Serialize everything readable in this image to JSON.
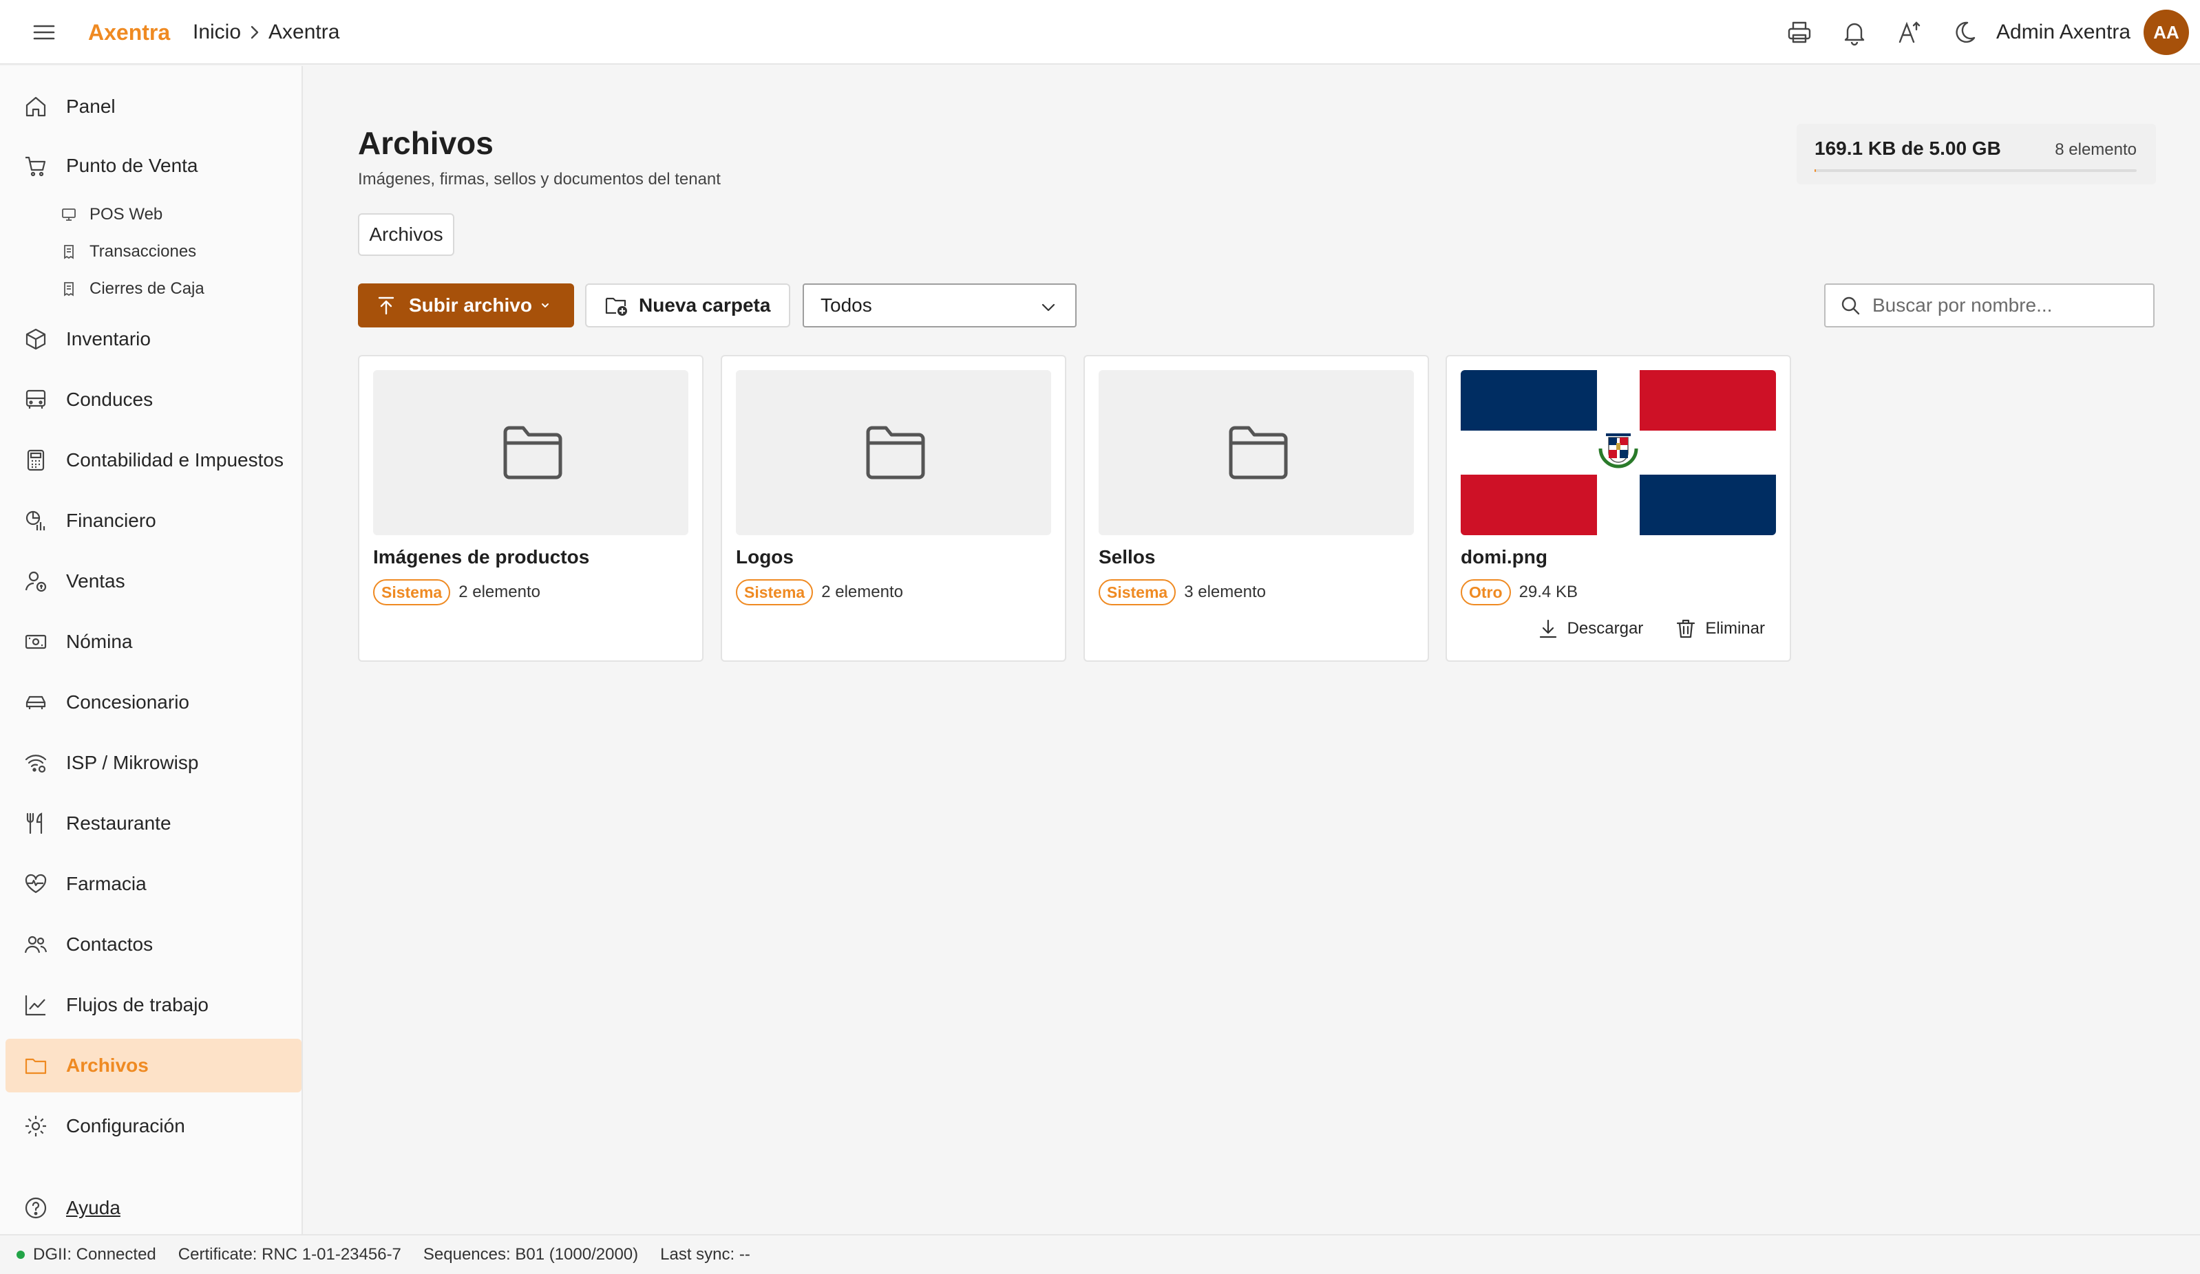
{
  "header": {
    "brand": "Axentra",
    "breadcrumb": [
      "Inicio",
      "Axentra"
    ],
    "user_name": "Admin Axentra",
    "avatar_initials": "AA",
    "icons": [
      "menu-icon",
      "printer-icon",
      "bell-icon",
      "accessibility-icon",
      "moon-icon"
    ]
  },
  "sidebar": {
    "items": [
      {
        "label": "Panel",
        "icon": "home-icon"
      },
      {
        "label": "Punto de Venta",
        "icon": "cart-icon"
      },
      {
        "label": "Inventario",
        "icon": "box-icon"
      },
      {
        "label": "Conduces",
        "icon": "truck-icon"
      },
      {
        "label": "Contabilidad e Impuestos",
        "icon": "calculator-icon"
      },
      {
        "label": "Financiero",
        "icon": "finance-icon"
      },
      {
        "label": "Ventas",
        "icon": "sales-icon"
      },
      {
        "label": "Nómina",
        "icon": "payroll-icon"
      },
      {
        "label": "Concesionario",
        "icon": "car-icon"
      },
      {
        "label": "ISP / Mikrowisp",
        "icon": "wifi-icon"
      },
      {
        "label": "Restaurante",
        "icon": "utensils-icon"
      },
      {
        "label": "Farmacia",
        "icon": "heartbeat-icon"
      },
      {
        "label": "Contactos",
        "icon": "users-icon"
      },
      {
        "label": "Flujos de trabajo",
        "icon": "chart-line-icon"
      },
      {
        "label": "Archivos",
        "icon": "folder-icon"
      },
      {
        "label": "Configuración",
        "icon": "gear-icon"
      }
    ],
    "subitems": [
      {
        "label": "POS Web",
        "icon": "monitor-icon"
      },
      {
        "label": "Transacciones",
        "icon": "receipt-icon"
      },
      {
        "label": "Cierres de Caja",
        "icon": "receipt-icon"
      }
    ],
    "active": "Archivos",
    "help_label": "Ayuda"
  },
  "main": {
    "title": "Archivos",
    "subtitle": "Imágenes, firmas, sellos y documentos del tenant",
    "storage": {
      "used": "169.1 KB de 5.00 GB",
      "count": "8 elemento",
      "usage_fraction": 3e-05
    },
    "tab": "Archivos",
    "upload_label": "Subir archivo",
    "new_folder_label": "Nueva carpeta",
    "filter_value": "Todos",
    "search_placeholder": "Buscar por nombre...",
    "cards": [
      {
        "name": "Imágenes de productos",
        "badge": "Sistema",
        "meta": "2 elemento",
        "kind": "folder"
      },
      {
        "name": "Logos",
        "badge": "Sistema",
        "meta": "2 elemento",
        "kind": "folder"
      },
      {
        "name": "Sellos",
        "badge": "Sistema",
        "meta": "3 elemento",
        "kind": "folder"
      },
      {
        "name": "domi.png",
        "badge": "Otro",
        "meta": "29.4 KB",
        "kind": "image",
        "download_label": "Descargar",
        "delete_label": "Eliminar"
      }
    ]
  },
  "statusbar": {
    "dgii": "DGII: Connected",
    "certificate": "Certificate: RNC 1-01-23456-7",
    "sequences": "Sequences: B01 (1000/2000)",
    "last_sync": "Last sync: --"
  },
  "colors": {
    "accent": "#ef8a22",
    "primary_button": "#a7510a",
    "active_nav_bg": "#fde2c8",
    "status_ok": "#22a447",
    "flag_blue": "#002d62",
    "flag_red": "#ce1126"
  }
}
